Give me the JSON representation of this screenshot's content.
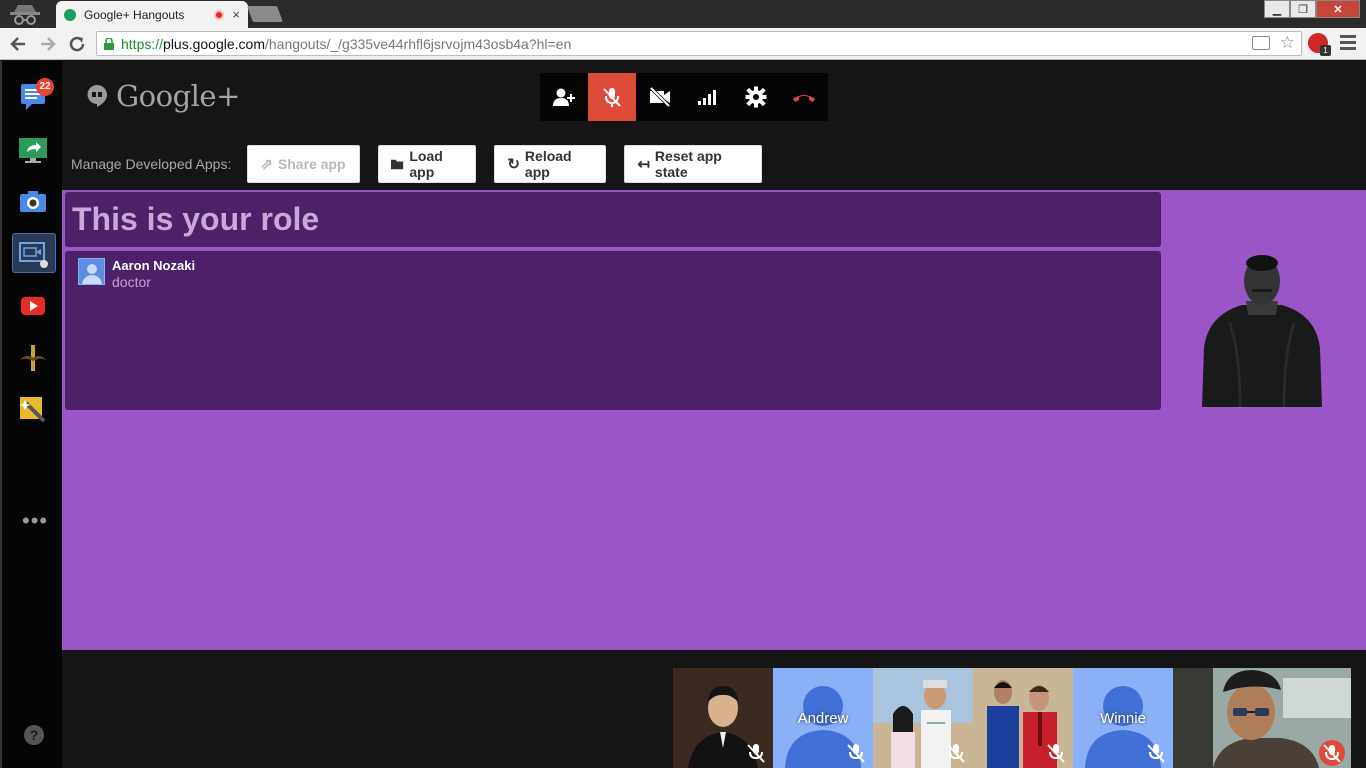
{
  "browser": {
    "tab_title": "Google+ Hangouts",
    "tab_close": "×",
    "url_scheme": "https://",
    "url_host": "plus.google.com",
    "url_path": "/hangouts/_/g335ve44rhfl6jsrvojm43osb4a?hl=en",
    "extension_badge": "1"
  },
  "rail": {
    "notification_count": "22",
    "items": [
      "chat-icon",
      "screenshare-icon",
      "camera-icon",
      "hangout-app-icon",
      "youtube-icon",
      "mustache-icon",
      "effects-icon"
    ],
    "more": "•••",
    "help": "?"
  },
  "header": {
    "logo_text": "Google+"
  },
  "controls": [
    "invite-icon",
    "mic-muted-icon",
    "camera-off-icon",
    "bandwidth-icon",
    "settings-icon",
    "hangup-icon"
  ],
  "devbar": {
    "label": "Manage Developed Apps:",
    "share": "Share app",
    "load": "Load app",
    "reload": "Reload app",
    "reset": "Reset app state"
  },
  "app": {
    "role_title": "This is your role",
    "participant_name": "Aaron Nozaki",
    "participant_role": "doctor"
  },
  "filmstrip": [
    {
      "name": "",
      "type": "photo"
    },
    {
      "name": "Andrew",
      "type": "avatar"
    },
    {
      "name": "",
      "type": "photo"
    },
    {
      "name": "",
      "type": "photo"
    },
    {
      "name": "Winnie",
      "type": "avatar"
    },
    {
      "name": "",
      "type": "video"
    }
  ],
  "colors": {
    "stage": "#9a55c6",
    "panel": "#4d206a",
    "mute_active": "#dd4b39"
  }
}
